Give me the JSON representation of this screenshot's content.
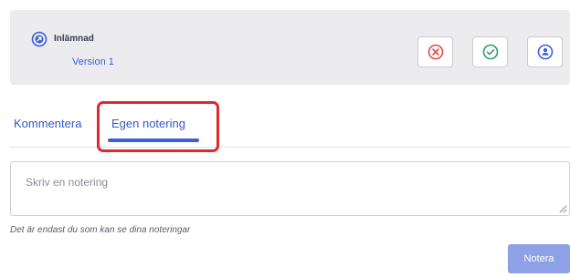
{
  "submission": {
    "status": "Inlämnad",
    "version": "Version 1",
    "status_icon": "arrow-circle-icon",
    "actions": [
      {
        "icon": "reject-circle-icon",
        "color": "#e24b4b"
      },
      {
        "icon": "approve-check-icon",
        "color": "#2e9f6a"
      },
      {
        "icon": "person-icon",
        "color": "#3b5fd9"
      }
    ]
  },
  "tabs": [
    {
      "label": "Kommentera",
      "active": false
    },
    {
      "label": "Egen notering",
      "active": true
    }
  ],
  "note": {
    "placeholder": "Skriv en notering",
    "value": "",
    "hint": "Det är endast du som kan se dina noteringar",
    "submit_label": "Notera"
  },
  "colors": {
    "accent": "#3b5fd9",
    "highlight": "#e0282e",
    "card_bg": "#ececef",
    "submit_disabled": "#8ea1e6"
  }
}
